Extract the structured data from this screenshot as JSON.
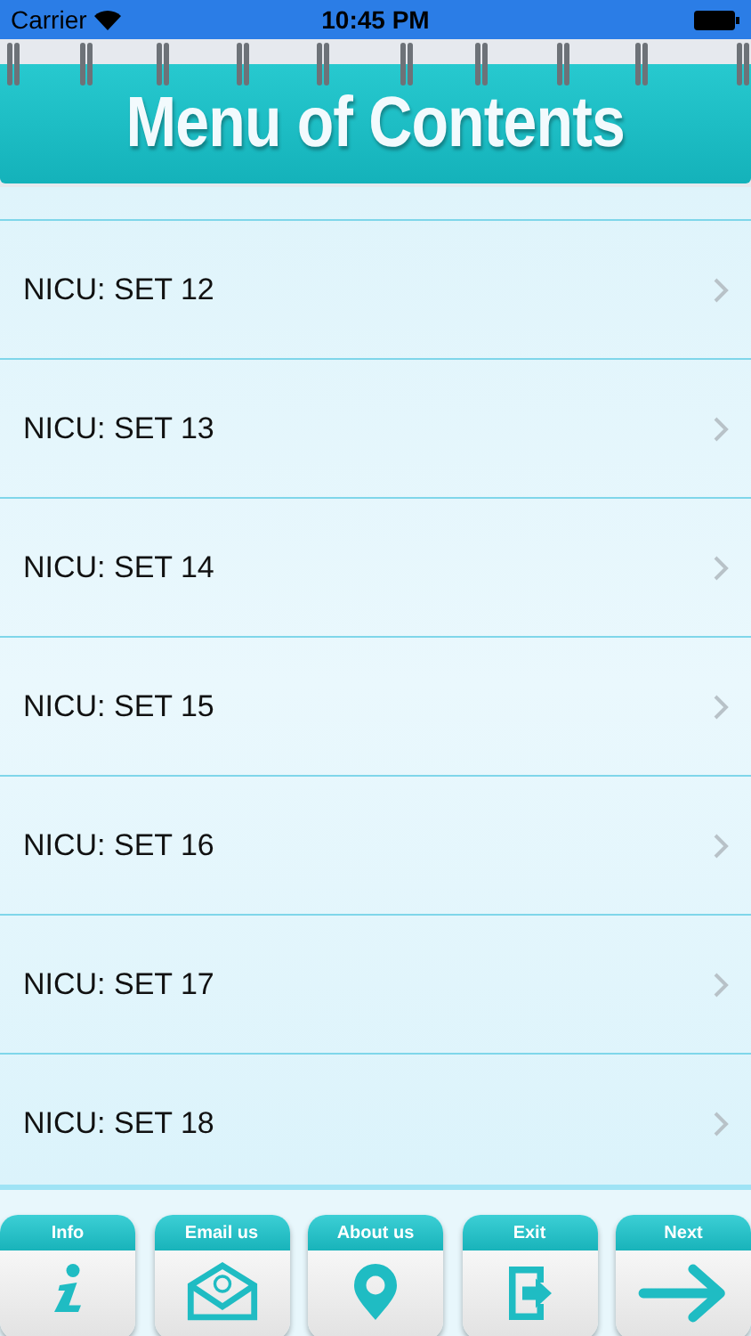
{
  "status_bar": {
    "carrier": "Carrier",
    "time": "10:45 PM"
  },
  "header": {
    "title": "Menu of Contents"
  },
  "menu": {
    "items": [
      {
        "label": "NICU: SET 12"
      },
      {
        "label": "NICU: SET 13"
      },
      {
        "label": "NICU: SET 14"
      },
      {
        "label": "NICU: SET 15"
      },
      {
        "label": "NICU: SET 16"
      },
      {
        "label": "NICU: SET 17"
      },
      {
        "label": "NICU: SET 18"
      }
    ]
  },
  "toolbar": {
    "buttons": [
      {
        "kind": "info",
        "label": "Info"
      },
      {
        "kind": "email",
        "label": "Email us"
      },
      {
        "kind": "about",
        "label": "About us"
      },
      {
        "kind": "exit",
        "label": "Exit"
      },
      {
        "kind": "next",
        "label": "Next"
      }
    ]
  }
}
